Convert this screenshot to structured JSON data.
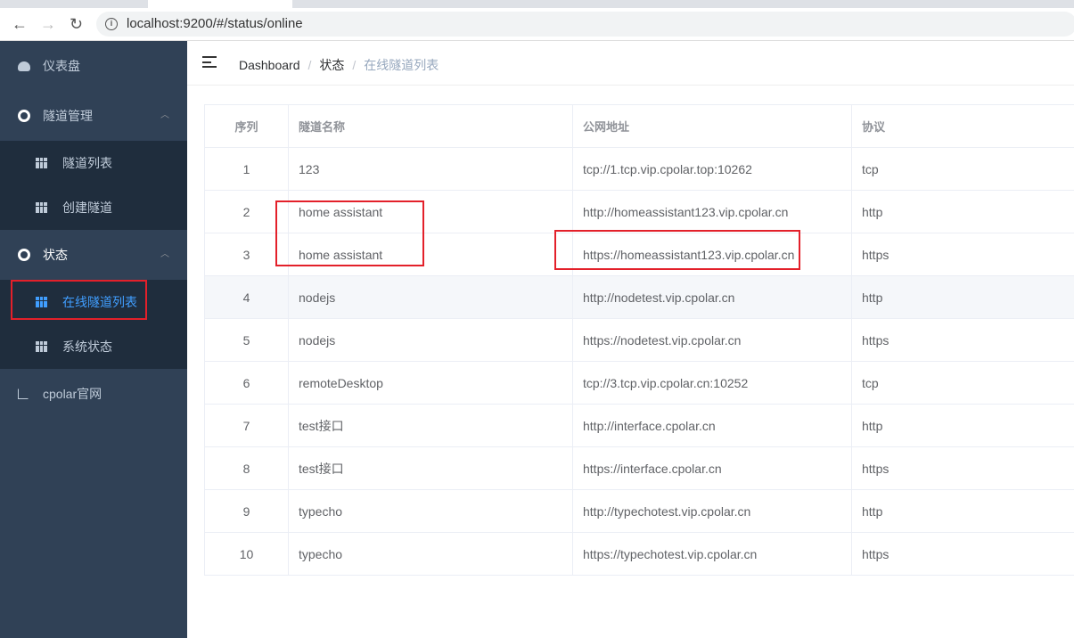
{
  "browser": {
    "url": "localhost:9200/#/status/online"
  },
  "sidebar": {
    "items": [
      {
        "label": "仪表盘"
      },
      {
        "label": "隧道管理"
      },
      {
        "label": "隧道列表"
      },
      {
        "label": "创建隧道"
      },
      {
        "label": "状态"
      },
      {
        "label": "在线隧道列表"
      },
      {
        "label": "系统状态"
      },
      {
        "label": "cpolar官网"
      }
    ]
  },
  "breadcrumb": [
    "Dashboard",
    "状态",
    "在线隧道列表"
  ],
  "table": {
    "headers": [
      "序列",
      "隧道名称",
      "公网地址",
      "协议"
    ],
    "rows": [
      [
        "1",
        "123",
        "tcp://1.tcp.vip.cpolar.top:10262",
        "tcp"
      ],
      [
        "2",
        "home assistant",
        "http://homeassistant123.vip.cpolar.cn",
        "http"
      ],
      [
        "3",
        "home assistant",
        "https://homeassistant123.vip.cpolar.cn",
        "https"
      ],
      [
        "4",
        "nodejs",
        "http://nodetest.vip.cpolar.cn",
        "http"
      ],
      [
        "5",
        "nodejs",
        "https://nodetest.vip.cpolar.cn",
        "https"
      ],
      [
        "6",
        "remoteDesktop",
        "tcp://3.tcp.vip.cpolar.cn:10252",
        "tcp"
      ],
      [
        "7",
        "test接口",
        "http://interface.cpolar.cn",
        "http"
      ],
      [
        "8",
        "test接口",
        "https://interface.cpolar.cn",
        "https"
      ],
      [
        "9",
        "typecho",
        "http://typechotest.vip.cpolar.cn",
        "http"
      ],
      [
        "10",
        "typecho",
        "https://typechotest.vip.cpolar.cn",
        "https"
      ]
    ]
  },
  "colors": {
    "sidebar": "#304156",
    "submenu": "#1f2d3d",
    "active": "#409eff",
    "highlight": "#e3202a"
  }
}
